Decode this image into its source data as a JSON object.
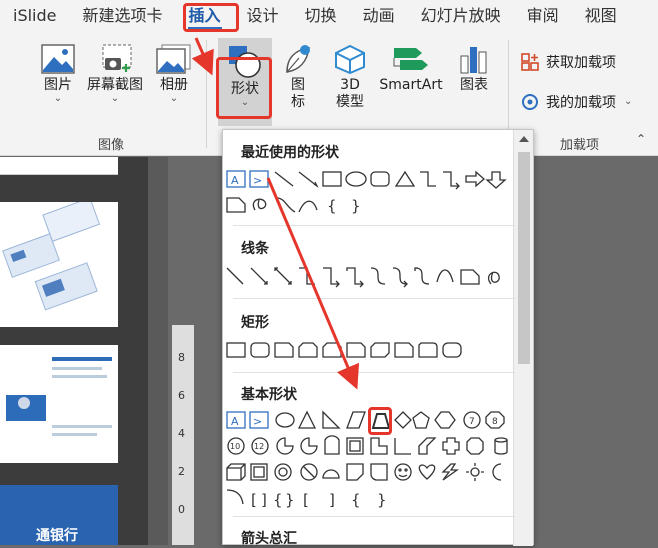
{
  "tabs": [
    "iSlide",
    "新建选项卡",
    "插入",
    "设计",
    "切换",
    "动画",
    "幻灯片放映",
    "审阅",
    "视图"
  ],
  "ribbon": {
    "picture": "图片",
    "screenshot": "屏幕截图",
    "album": "相册",
    "images_group": "图像",
    "shapes": "形状",
    "icons_l1": "图",
    "icons_l2": "标",
    "model_l1": "3D",
    "model_l2": "模型",
    "smartart": "SmartArt",
    "chart": "图表",
    "get_addins": "获取加载项",
    "my_addins": "我的加载项",
    "addins_group": "加载项"
  },
  "dropdown": {
    "recent": "最近使用的形状",
    "lines": "线条",
    "rect": "矩形",
    "basic": "基本形状",
    "arrows": "箭头总汇"
  },
  "ruler": [
    "8",
    "6",
    "4",
    "2",
    "0"
  ],
  "thumb_text": "通银行",
  "colors": {
    "accent": "#2f6fc0",
    "highlight": "#e5362c"
  }
}
